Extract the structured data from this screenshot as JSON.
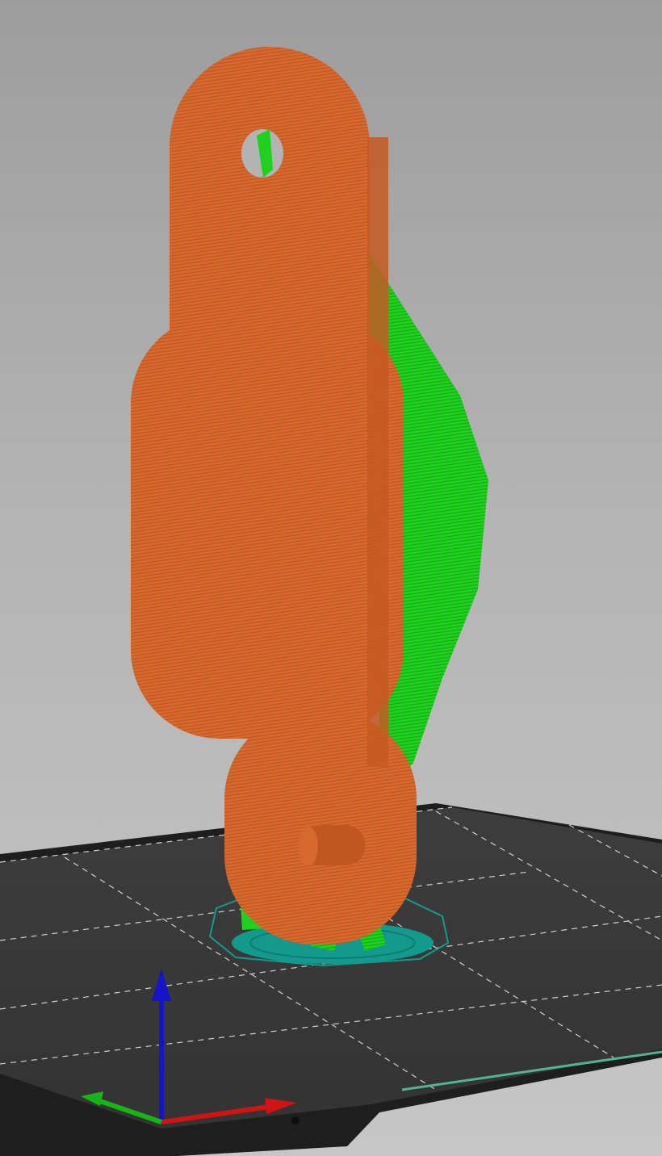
{
  "viewport": {
    "label": "",
    "colors": {
      "background_top": "#9d9d9d",
      "background_bottom": "#c6c6c6",
      "bed": "#3a3a3a",
      "bed_frame": "#1e1e1e",
      "grid_line": "#cfcfcf",
      "model_extrusion": "#d8692e",
      "model_shadow": "#b9551f",
      "support_material": "#1fd01f",
      "support_dark": "#12a612",
      "brim_skirt": "#149a8c",
      "axis_x": "#d01414",
      "axis_y": "#17b617",
      "axis_z": "#1414c8"
    },
    "icons": [
      "x-axis-arrow-icon",
      "y-axis-arrow-icon",
      "z-axis-arrow-icon"
    ]
  }
}
